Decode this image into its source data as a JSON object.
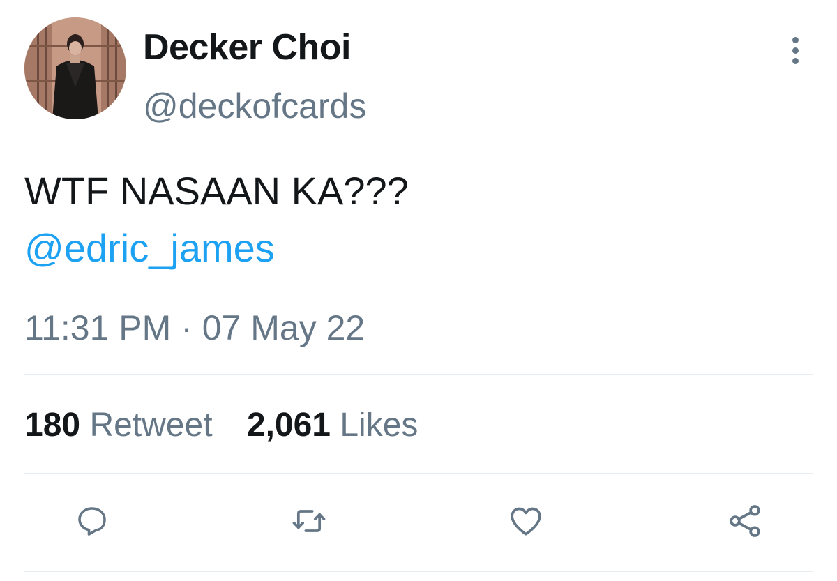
{
  "tweet": {
    "author": {
      "display_name": "Decker Choi",
      "handle": "@deckofcards"
    },
    "text": "WTF NASAAN KA???",
    "mention": "@edric_james",
    "timestamp": "11:31 PM · 07 May 22",
    "stats": {
      "retweets": {
        "count": "180",
        "label": "Retweet"
      },
      "likes": {
        "count": "2,061",
        "label": "Likes"
      }
    },
    "actions": [
      {
        "icon": "reply-icon"
      },
      {
        "icon": "retweet-icon"
      },
      {
        "icon": "like-icon"
      },
      {
        "icon": "share-icon"
      }
    ]
  },
  "colors": {
    "text_primary": "#14171a",
    "text_secondary": "#657786",
    "link": "#1da1f2",
    "divider": "#e6ecf0",
    "background": "#ffffff"
  }
}
